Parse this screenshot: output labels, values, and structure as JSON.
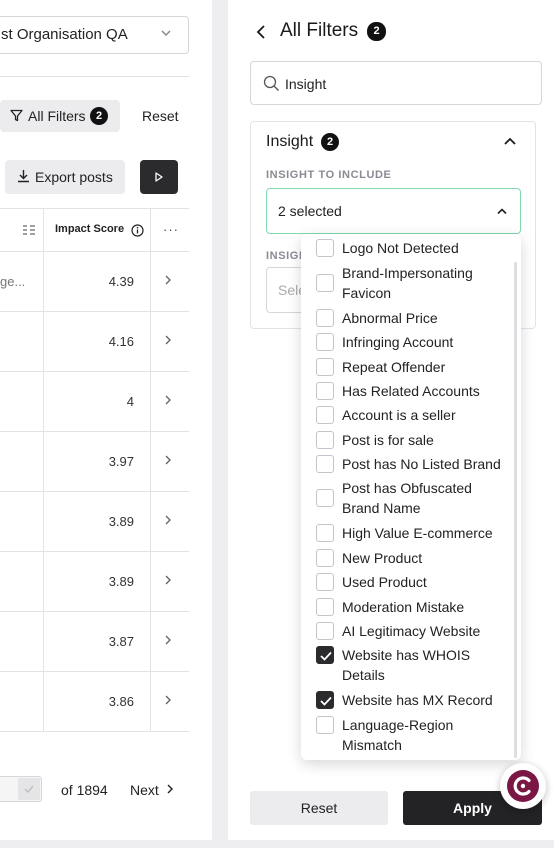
{
  "left_panel": {
    "org_select_value": "st Organisation QA",
    "all_filters_label": "All Filters",
    "all_filters_count": "2",
    "reset_label": "Reset",
    "export_label": "Export posts",
    "table": {
      "impact_header": "Impact Score",
      "more_label": "···",
      "rows": [
        {
          "c1": "ge...",
          "score": "4.39"
        },
        {
          "c1": "",
          "score": "4.16"
        },
        {
          "c1": "",
          "score": "4"
        },
        {
          "c1": "",
          "score": "3.97"
        },
        {
          "c1": "",
          "score": "3.89"
        },
        {
          "c1": "",
          "score": "3.89"
        },
        {
          "c1": "",
          "score": "3.87"
        },
        {
          "c1": "",
          "score": "3.86"
        }
      ]
    },
    "pager": {
      "of_label": "of 1894",
      "next_label": "Next"
    }
  },
  "right_panel": {
    "title": "All Filters",
    "count": "2",
    "search_value": "Insight",
    "section": {
      "title": "Insight",
      "count": "2",
      "include_label": "INSIGHT TO INCLUDE",
      "include_value": "2 selected",
      "exclude_label_fragment": "INSIGH",
      "exclude_placeholder_fragment": "Sele"
    },
    "footer": {
      "reset_label": "Reset",
      "apply_label": "Apply"
    }
  },
  "dropdown_options": [
    {
      "label": "Logo Not Detected",
      "checked": false
    },
    {
      "label": "Brand-Impersonating Favicon",
      "checked": false
    },
    {
      "label": "Abnormal Price",
      "checked": false
    },
    {
      "label": "Infringing Account",
      "checked": false
    },
    {
      "label": "Repeat Offender",
      "checked": false
    },
    {
      "label": "Has Related Accounts",
      "checked": false
    },
    {
      "label": "Account is a seller",
      "checked": false
    },
    {
      "label": "Post is for sale",
      "checked": false
    },
    {
      "label": "Post has No Listed Brand",
      "checked": false
    },
    {
      "label": "Post has Obfuscated Brand Name",
      "checked": false
    },
    {
      "label": "High Value E-commerce",
      "checked": false
    },
    {
      "label": "New Product",
      "checked": false
    },
    {
      "label": "Used Product",
      "checked": false
    },
    {
      "label": "Moderation Mistake",
      "checked": false
    },
    {
      "label": "AI Legitimacy Website",
      "checked": false
    },
    {
      "label": "Website has WHOIS Details",
      "checked": true
    },
    {
      "label": "Website has MX Record",
      "checked": true
    },
    {
      "label": "Language-Region Mismatch",
      "checked": false
    }
  ],
  "colors": {
    "accent_border": "#7fd9b0",
    "primary_button": "#232325",
    "fab_brand": "#7a1745"
  }
}
